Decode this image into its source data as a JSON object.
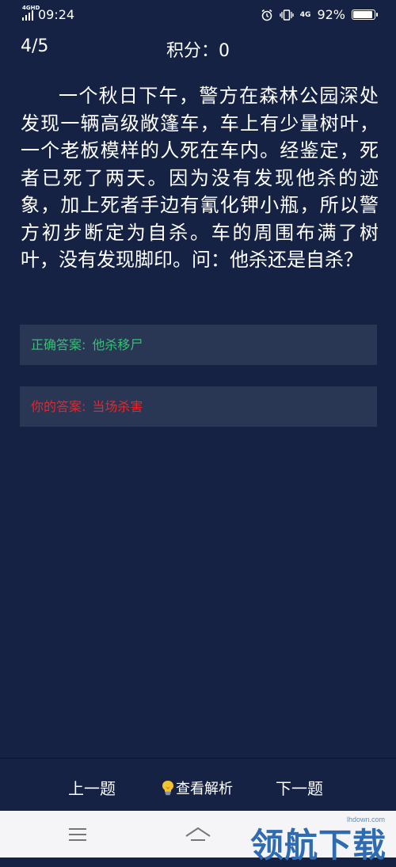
{
  "status": {
    "network": "4GHD",
    "time": "09:24",
    "network_right": "4G",
    "battery": "92%",
    "battery_level": 0.92
  },
  "header": {
    "progress": "4/5",
    "score": "积分：0"
  },
  "question": {
    "text": "一个秋日下午，警方在森林公园深处发现一辆高级敞篷车，车上有少量树叶，一个老板模样的人死在车内。经鉴定，死者已死了两天。因为没有发现他杀的迹象，加上死者手边有氰化钾小瓶，所以警方初步断定为自杀。车的周围布满了树叶，没有发现脚印。问：他杀还是自杀？"
  },
  "answers": {
    "correct_label": "正确答案:",
    "correct_value": "他杀移尸",
    "user_label": "你的答案:",
    "user_value": "当场杀害"
  },
  "bottom_nav": {
    "prev": "上一题",
    "analysis": "查看解析",
    "next": "下一题"
  },
  "watermark": {
    "text": "领航下载",
    "url": "lhdown.com"
  },
  "colors": {
    "background": "#162244",
    "answer_box": "#2a3754",
    "correct": "#2fc46f",
    "wrong": "#e6262b"
  },
  "icons": [
    "signal-icon",
    "alarm-icon",
    "vibrate-icon",
    "battery-icon",
    "lightbulb-icon",
    "menu-icon",
    "home-icon"
  ]
}
